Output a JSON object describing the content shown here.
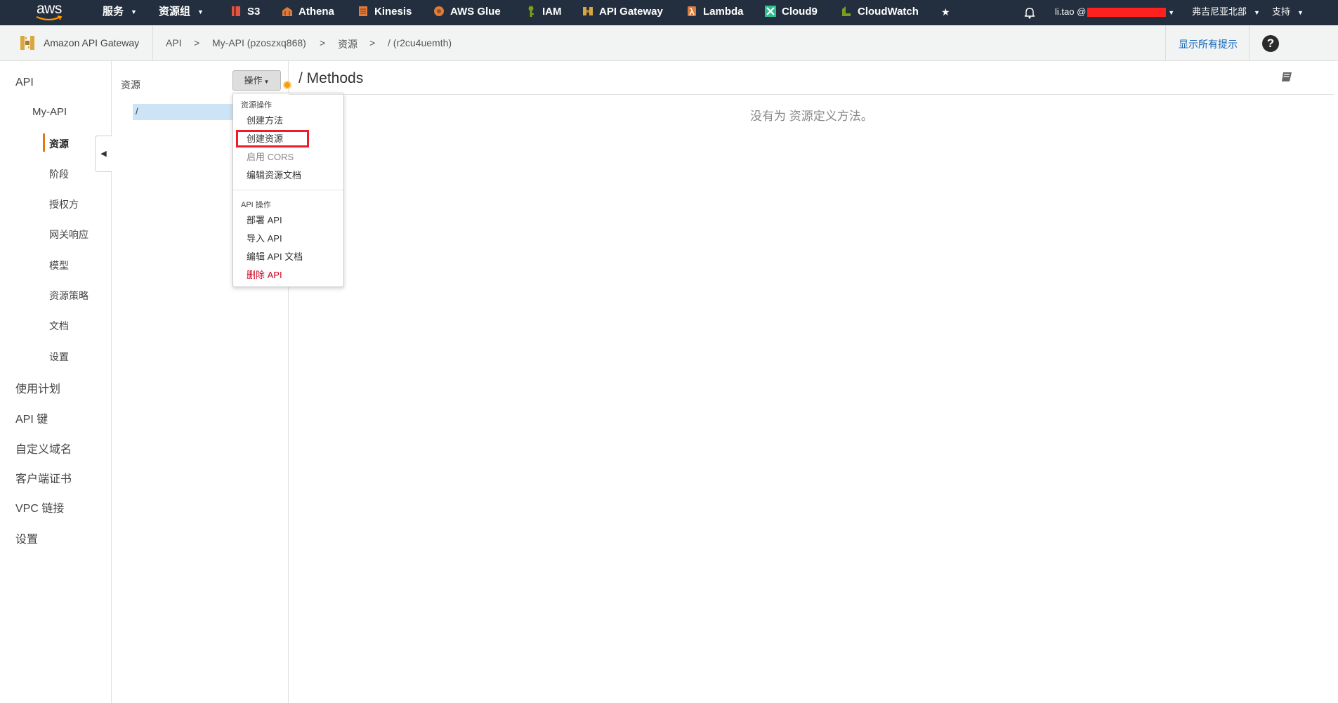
{
  "topnav": {
    "logo": "aws",
    "services_label": "服务",
    "resource_groups_label": "资源组",
    "shortcuts": [
      {
        "label": "S3",
        "icon": "s3-icon",
        "color": "#e25444"
      },
      {
        "label": "Athena",
        "icon": "athena-icon",
        "color": "#e07b39"
      },
      {
        "label": "Kinesis",
        "icon": "kinesis-icon",
        "color": "#e07b39"
      },
      {
        "label": "AWS Glue",
        "icon": "glue-icon",
        "color": "#e07b39"
      },
      {
        "label": "IAM",
        "icon": "iam-icon",
        "color": "#7aa116"
      },
      {
        "label": "API Gateway",
        "icon": "api-gateway-icon",
        "color": "#d9a741"
      },
      {
        "label": "Lambda",
        "icon": "lambda-icon",
        "color": "#e07b39"
      },
      {
        "label": "Cloud9",
        "icon": "cloud9-icon",
        "color": "#2ebf91"
      },
      {
        "label": "CloudWatch",
        "icon": "cloudwatch-icon",
        "color": "#7aa116"
      }
    ],
    "user_label": "li.tao @",
    "region_label": "弗吉尼亚北部",
    "support_label": "支持"
  },
  "breadcrumb": {
    "brand": "Amazon API Gateway",
    "items": [
      "API",
      "My-API (pzoszxq868)",
      "资源",
      "/ (r2cu4uemth)"
    ],
    "separator": ">",
    "hints_link": "显示所有提示",
    "help_symbol": "?"
  },
  "leftnav": {
    "api": "API",
    "my_api": "My-API",
    "resources": "资源",
    "stages": "阶段",
    "authorizers": "授权方",
    "gateway_responses": "网关响应",
    "models": "模型",
    "resource_policy": "资源策略",
    "documentation": "文档",
    "settings_sub": "设置",
    "usage_plans": "使用计划",
    "api_keys": "API 键",
    "custom_domains": "自定义域名",
    "client_certs": "客户端证书",
    "vpc_links": "VPC 链接",
    "settings": "设置"
  },
  "resources_panel": {
    "title": "资源",
    "actions_button": "操作",
    "root_path": "/"
  },
  "actions_menu": {
    "resource_header": "资源操作",
    "resource_items": [
      {
        "label": "创建方法",
        "state": "normal"
      },
      {
        "label": "创建资源",
        "state": "highlighted"
      },
      {
        "label": "启用 CORS",
        "state": "disabled"
      },
      {
        "label": "编辑资源文档",
        "state": "normal"
      }
    ],
    "api_header": "API 操作",
    "api_items": [
      {
        "label": "部署 API",
        "state": "normal"
      },
      {
        "label": "导入 API",
        "state": "normal"
      },
      {
        "label": "编辑 API 文档",
        "state": "normal"
      },
      {
        "label": "删除 API",
        "state": "danger"
      }
    ]
  },
  "main": {
    "title": "/ Methods",
    "empty_message": "没有为 资源定义方法。"
  },
  "colors": {
    "topbar_bg": "#232f3e",
    "accent_orange": "#e47911",
    "link_blue": "#1166bb",
    "danger_red": "#d0021b",
    "selection_blue": "#cde3f6"
  }
}
